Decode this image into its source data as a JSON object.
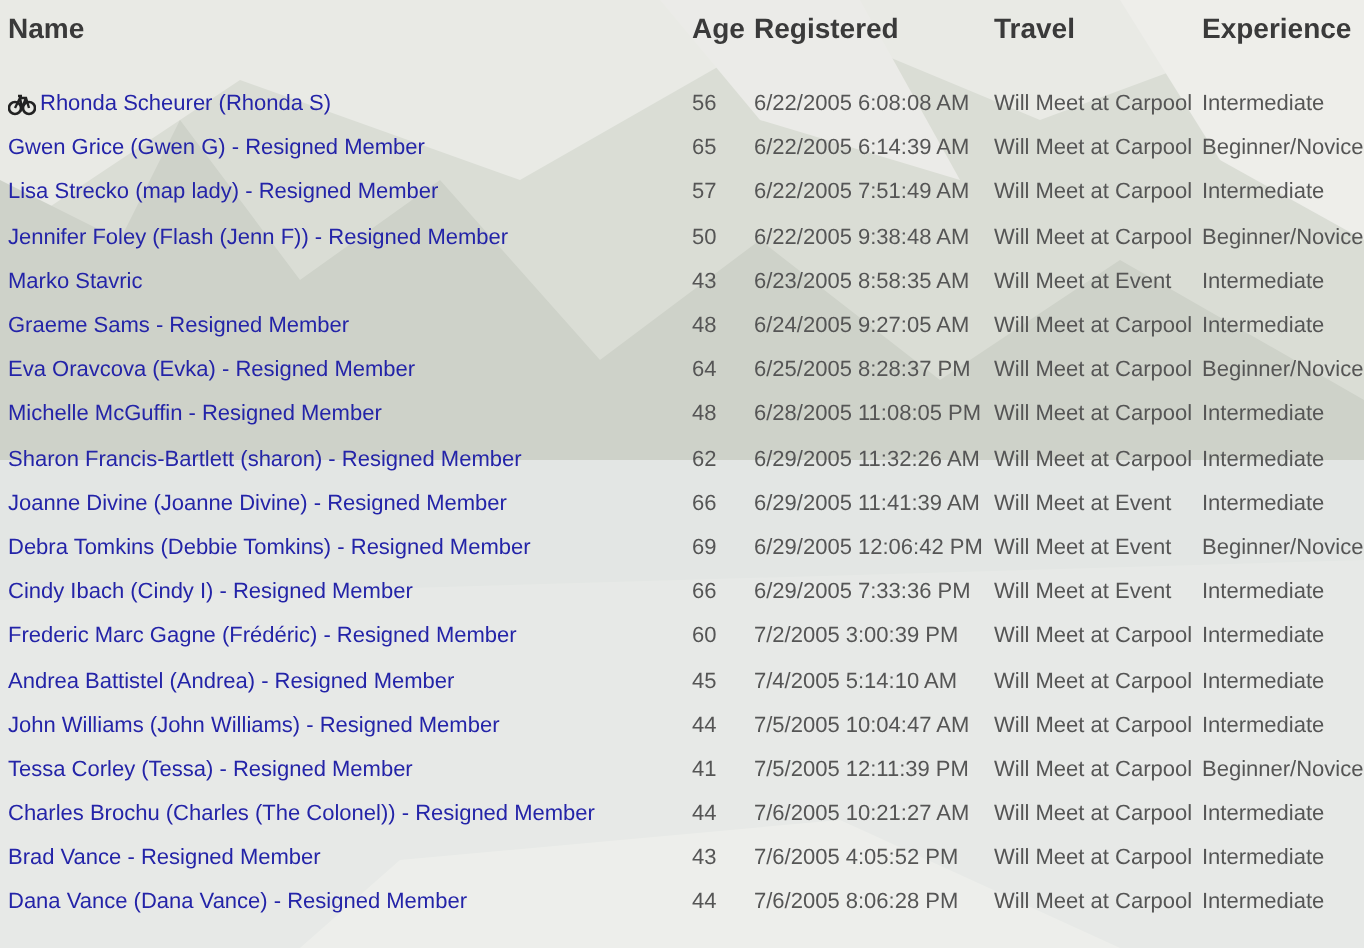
{
  "columns": [
    "Name",
    "Age",
    "Registered",
    "Travel",
    "Experience"
  ],
  "rows": [
    {
      "name": "Rhonda Scheurer (Rhonda S)",
      "flagged": true,
      "age": "56",
      "registered": "6/22/2005 6:08:08 AM",
      "travel": "Will Meet at Carpool",
      "experience": "Intermediate"
    },
    {
      "name": "Gwen Grice (Gwen G) - Resigned Member",
      "flagged": false,
      "age": "65",
      "registered": "6/22/2005 6:14:39 AM",
      "travel": "Will Meet at Carpool",
      "experience": "Beginner/Novice"
    },
    {
      "name": "Lisa Strecko (map lady) - Resigned Member",
      "flagged": false,
      "age": "57",
      "registered": "6/22/2005 7:51:49 AM",
      "travel": "Will Meet at Carpool",
      "experience": "Intermediate"
    },
    {
      "name": "Jennifer Foley (Flash (Jenn F)) - Resigned Member",
      "flagged": false,
      "age": "50",
      "registered": "6/22/2005 9:38:48 AM",
      "travel": "Will Meet at Carpool",
      "experience": "Beginner/Novice"
    },
    {
      "name": "Marko Stavric",
      "flagged": false,
      "age": "43",
      "registered": "6/23/2005 8:58:35 AM",
      "travel": "Will Meet at Event",
      "experience": "Intermediate"
    },
    {
      "name": "Graeme Sams - Resigned Member",
      "flagged": false,
      "age": "48",
      "registered": "6/24/2005 9:27:05 AM",
      "travel": "Will Meet at Carpool",
      "experience": "Intermediate"
    },
    {
      "name": "Eva Oravcova (Evka) - Resigned Member",
      "flagged": false,
      "age": "64",
      "registered": "6/25/2005 8:28:37 PM",
      "travel": "Will Meet at Carpool",
      "experience": "Beginner/Novice"
    },
    {
      "name": "Michelle McGuffin - Resigned Member",
      "flagged": false,
      "age": "48",
      "registered": "6/28/2005 11:08:05 PM",
      "travel": "Will Meet at Carpool",
      "experience": "Intermediate"
    },
    {
      "name": "Sharon Francis-Bartlett (sharon) - Resigned Member",
      "flagged": false,
      "age": "62",
      "registered": "6/29/2005 11:32:26 AM",
      "travel": "Will Meet at Carpool",
      "experience": "Intermediate"
    },
    {
      "name": "Joanne Divine (Joanne Divine) - Resigned Member",
      "flagged": false,
      "age": "66",
      "registered": "6/29/2005 11:41:39 AM",
      "travel": "Will Meet at Event",
      "experience": "Intermediate"
    },
    {
      "name": "Debra Tomkins (Debbie Tomkins) - Resigned Member",
      "flagged": false,
      "age": "69",
      "registered": "6/29/2005 12:06:42 PM",
      "travel": "Will Meet at Event",
      "experience": "Beginner/Novice"
    },
    {
      "name": "Cindy Ibach (Cindy I) - Resigned Member",
      "flagged": false,
      "age": "66",
      "registered": "6/29/2005 7:33:36 PM",
      "travel": "Will Meet at Event",
      "experience": "Intermediate"
    },
    {
      "name": "Frederic Marc Gagne (Frédéric) - Resigned Member",
      "flagged": false,
      "age": "60",
      "registered": "7/2/2005 3:00:39 PM",
      "travel": "Will Meet at Carpool",
      "experience": "Intermediate"
    },
    {
      "name": "Andrea Battistel (Andrea) - Resigned Member",
      "flagged": false,
      "age": "45",
      "registered": "7/4/2005 5:14:10 AM",
      "travel": "Will Meet at Carpool",
      "experience": "Intermediate"
    },
    {
      "name": "John Williams (John Williams) - Resigned Member",
      "flagged": false,
      "age": "44",
      "registered": "7/5/2005 10:04:47 AM",
      "travel": "Will Meet at Carpool",
      "experience": "Intermediate"
    },
    {
      "name": "Tessa Corley (Tessa) - Resigned Member",
      "flagged": false,
      "age": "41",
      "registered": "7/5/2005 12:11:39 PM",
      "travel": "Will Meet at Carpool",
      "experience": "Beginner/Novice"
    },
    {
      "name": "Charles Brochu (Charles (The Colonel)) - Resigned Member",
      "flagged": false,
      "age": "44",
      "registered": "7/6/2005 10:21:27 AM",
      "travel": "Will Meet at Carpool",
      "experience": "Intermediate"
    },
    {
      "name": "Brad Vance - Resigned Member",
      "flagged": false,
      "age": "43",
      "registered": "7/6/2005 4:05:52 PM",
      "travel": "Will Meet at Carpool",
      "experience": "Intermediate"
    },
    {
      "name": "Dana Vance (Dana Vance) - Resigned Member",
      "flagged": false,
      "age": "44",
      "registered": "7/6/2005 8:06:28 PM",
      "travel": "Will Meet at Carpool",
      "experience": "Intermediate"
    }
  ]
}
